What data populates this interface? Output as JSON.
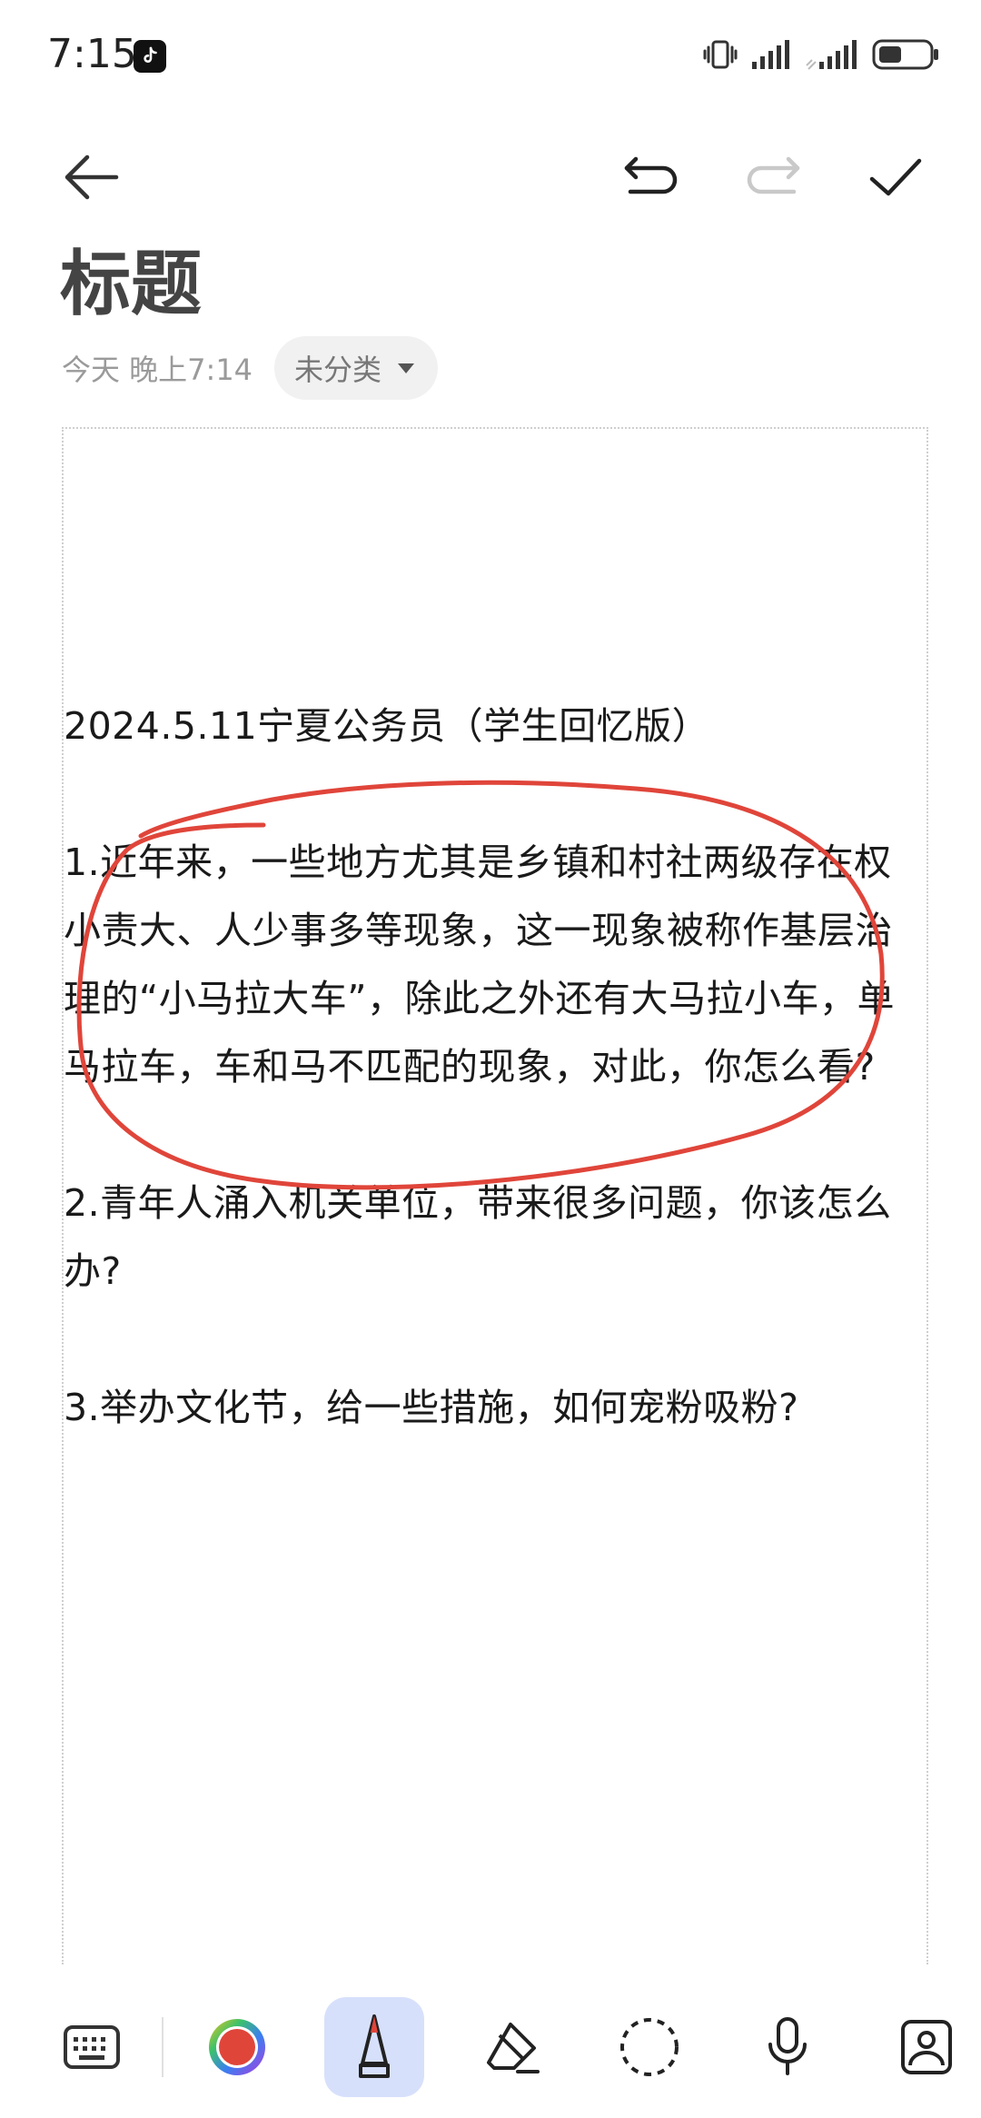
{
  "status_bar": {
    "time": "7:15",
    "app_icon": "tiktok-icon",
    "icons": [
      "vibrate-icon",
      "signal-icon",
      "signal-icon",
      "battery-icon"
    ]
  },
  "toolbar": {
    "back_icon": "arrow-left-icon",
    "undo_icon": "undo-icon",
    "redo_icon": "redo-icon",
    "done_icon": "check-icon"
  },
  "note": {
    "title": "标题",
    "date": "今天 晚上7:14",
    "category": "未分类",
    "paragraphs": [
      "2024.5.11宁夏公务员（学生回忆版）",
      "1.近年来，一些地方尤其是乡镇和村社两级存在权小责大、人少事多等现象，这一现象被称作基层治理的“小马拉大车”，除此之外还有大马拉小车，单马拉车，车和马不匹配的现象，对此，你怎么看?",
      "2.青年人涌入机关单位，带来很多问题，你该怎么办?",
      "3.举办文化节，给一些措施，如何宠粉吸粉?"
    ]
  },
  "colors": {
    "ink": "#e0453a",
    "active_tool_bg": "#d7e0fb"
  },
  "bottom_toolbar": {
    "tools": [
      "keyboard-icon",
      "color-picker-icon",
      "pen-icon",
      "eraser-icon",
      "lasso-icon",
      "microphone-icon",
      "image-icon"
    ],
    "active": "pen-icon"
  }
}
